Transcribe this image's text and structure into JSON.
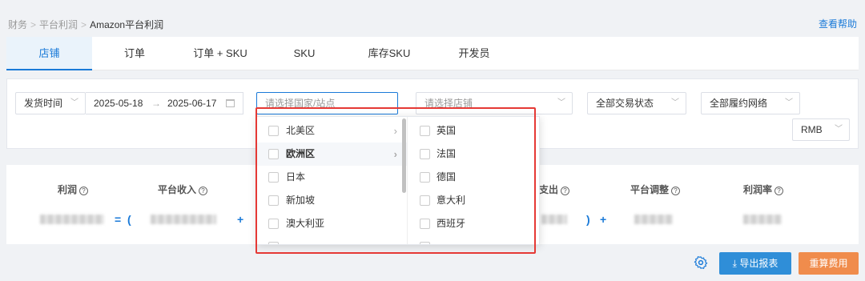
{
  "breadcrumb": {
    "items": [
      "财务",
      "平台利润"
    ],
    "current": "Amazon平台利润",
    "sep": ">"
  },
  "help_link": "查看帮助",
  "tabs": [
    "店铺",
    "订单",
    "订单 + SKU",
    "SKU",
    "库存SKU",
    "开发员"
  ],
  "filters": {
    "date_type": "发货时间",
    "date_start": "2025-05-18",
    "date_end": "2025-06-17",
    "date_arrow": "→",
    "country_placeholder": "请选择国家/站点",
    "store_placeholder": "请选择店铺",
    "trade_status": "全部交易状态",
    "fulfillment": "全部履约网络",
    "currency": "RMB"
  },
  "dropdown": {
    "regions": [
      {
        "label": "北美区",
        "has_children": true
      },
      {
        "label": "欧洲区",
        "has_children": true,
        "hover": true
      },
      {
        "label": "日本",
        "has_children": false
      },
      {
        "label": "新加坡",
        "has_children": false
      },
      {
        "label": "澳大利亚",
        "has_children": false
      }
    ],
    "countries": [
      "英国",
      "法国",
      "德国",
      "意大利",
      "西班牙"
    ]
  },
  "stats": {
    "labels": [
      "利润",
      "平台收入",
      "支出",
      "平台调整",
      "利润率"
    ],
    "help_glyph": "?",
    "operators": [
      "=",
      "(",
      "+",
      ")",
      "+"
    ]
  },
  "actions": {
    "export": "导出报表",
    "reset": "重算费用"
  },
  "colors": {
    "accent": "#1a7ad8",
    "highlight": "#e53935",
    "reset_btn": "#f08c4c",
    "export_btn": "#2f8ed8"
  }
}
